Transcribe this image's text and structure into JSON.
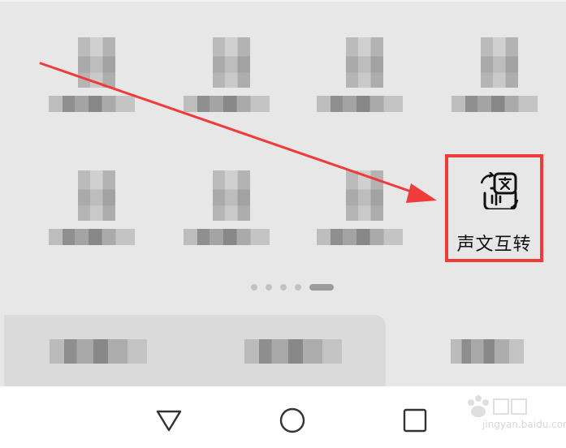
{
  "feature": {
    "label": "声文互转",
    "icon": "voice-text-convert-icon",
    "highlight_color": "#f03b3b"
  },
  "page_indicator": {
    "count": 5,
    "active": 5
  },
  "nav": {
    "back_icon": "triangle-back-icon",
    "home_icon": "circle-home-icon",
    "recents_icon": "square-recents-icon"
  },
  "watermark": {
    "text": "jingyan.baidu.com"
  },
  "annotation": {
    "arrow_color": "#f03b3b"
  }
}
